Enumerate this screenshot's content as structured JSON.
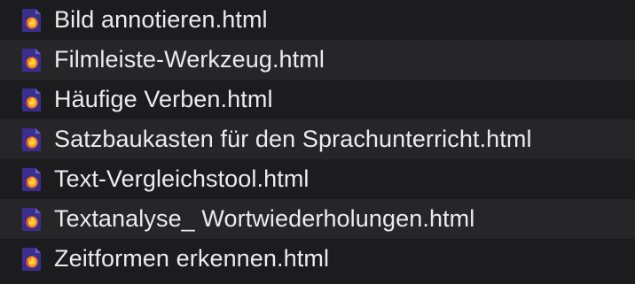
{
  "files": [
    {
      "name": "Bild annotieren.html",
      "icon": "firefox-html-document-icon"
    },
    {
      "name": "Filmleiste-Werkzeug.html",
      "icon": "firefox-html-document-icon"
    },
    {
      "name": "Häufige Verben.html",
      "icon": "firefox-html-document-icon"
    },
    {
      "name": "Satzbaukasten für den Sprachunterricht.html",
      "icon": "firefox-html-document-icon"
    },
    {
      "name": "Text-Vergleichstool.html",
      "icon": "firefox-html-document-icon"
    },
    {
      "name": "Textanalyse_ Wortwiederholungen.html",
      "icon": "firefox-html-document-icon"
    },
    {
      "name": "Zeitformen erkennen.html",
      "icon": "firefox-html-document-icon"
    }
  ],
  "colors": {
    "background_odd": "#1c1c1e",
    "background_even": "#262628",
    "text": "#ececec",
    "icon_page": "#3a2f8f",
    "icon_flame_orange": "#ff7a18",
    "icon_flame_yellow": "#ffd43b",
    "icon_flame_pink": "#e0245e"
  }
}
